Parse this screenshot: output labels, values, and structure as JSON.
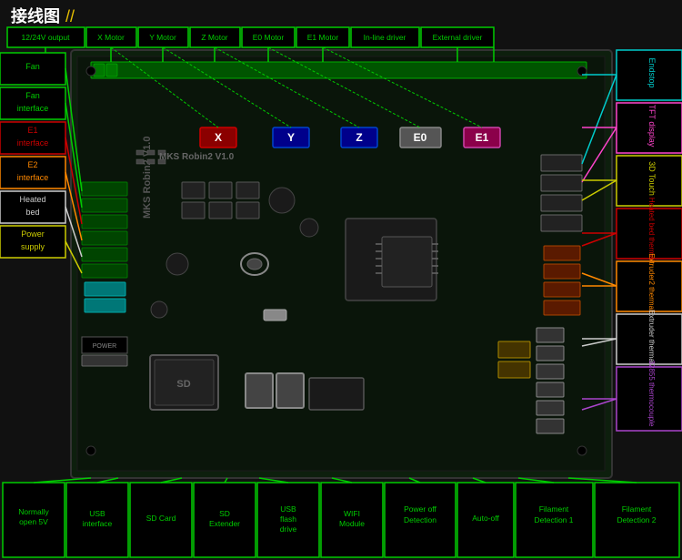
{
  "title": {
    "text": "接线图",
    "icon": "//",
    "subtitle": ""
  },
  "top_labels": [
    "12/24V output",
    "X Motor",
    "Y Motor",
    "Z Motor",
    "E0 Motor",
    "E1 Motor",
    "In-line driver",
    "External driver"
  ],
  "left_labels": [
    {
      "text": "Fan",
      "color": "green"
    },
    {
      "text": "Fan interface",
      "color": "green"
    },
    {
      "text": "E1 interface",
      "color": "red"
    },
    {
      "text": "E2 interface",
      "color": "orange"
    },
    {
      "text": "Heated bed",
      "color": "white"
    },
    {
      "text": "Power supply",
      "color": "yellow"
    }
  ],
  "right_labels": [
    {
      "text": "Endstop",
      "color": "cyan"
    },
    {
      "text": "TFT display",
      "color": "pink"
    },
    {
      "text": "3D Touch",
      "color": "yellow"
    },
    {
      "text": "Heated bed thermal",
      "color": "red"
    },
    {
      "text": "Extruder2 thermal",
      "color": "orange"
    },
    {
      "text": "Extruder thermal",
      "color": "white"
    },
    {
      "text": "32855 thermocouple",
      "color": "purple"
    }
  ],
  "bottom_labels": [
    {
      "text": "Normally open 5V",
      "color": "green"
    },
    {
      "text": "USB interface",
      "color": "green"
    },
    {
      "text": "SD Card",
      "color": "green"
    },
    {
      "text": "SD Extender",
      "color": "green"
    },
    {
      "text": "USB flash drive",
      "color": "green"
    },
    {
      "text": "WIFI Module",
      "color": "green"
    },
    {
      "text": "Power off Detection",
      "color": "green"
    },
    {
      "text": "Auto-off",
      "color": "green"
    },
    {
      "text": "Filament Detection 1",
      "color": "green"
    },
    {
      "text": "Filament Detection 2",
      "color": "green"
    }
  ],
  "board_name": "MKS Robin2 V1.0",
  "motor_labels": [
    "X",
    "Y",
    "Z",
    "E0",
    "E1"
  ],
  "colors": {
    "border_green": "#00cc00",
    "border_red": "#cc0000",
    "text_green": "#00cc00",
    "pcb_bg": "#0a1a0a",
    "bg": "#111111"
  }
}
